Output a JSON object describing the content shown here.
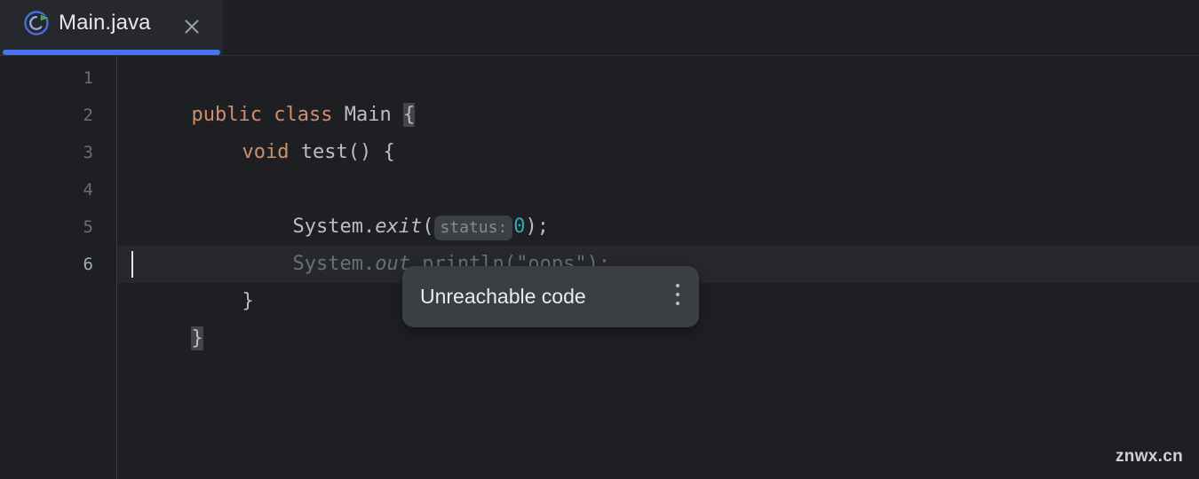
{
  "window": {
    "background": "#1e1f22",
    "watermark": "znwx.cn"
  },
  "tab_bar": {
    "active_tab": {
      "label": "Main.java",
      "icon": "java-class-runnable-icon",
      "close_icon": "close-icon",
      "underline_color": "#4874ef",
      "background": "#26282e"
    }
  },
  "editor": {
    "language": "java",
    "caret": {
      "line": 6,
      "column": 2
    },
    "gutter": {
      "line_numbers": [
        "1",
        "2",
        "3",
        "4",
        "5",
        "6"
      ],
      "current_line": "6"
    },
    "colors": {
      "keyword": "#cf8e6d",
      "identifier": "#bcbec4",
      "number": "#2aacb8",
      "string": "#6aab73",
      "greyed_out": "#6b6f76",
      "inlay_background": "#3c3f43",
      "inlay_text": "#868a91",
      "brace_match_highlight": "#43454a",
      "caret_line": "#26282e"
    },
    "lines": [
      {
        "number": "1",
        "indent": 0,
        "tokens": [
          {
            "text": "public",
            "style": "keyword"
          },
          {
            "text": " ",
            "style": "plain"
          },
          {
            "text": "class",
            "style": "keyword"
          },
          {
            "text": " ",
            "style": "plain"
          },
          {
            "text": "Main",
            "style": "identifier"
          },
          {
            "text": " ",
            "style": "plain"
          },
          {
            "text": "{",
            "style": "brace-match"
          }
        ]
      },
      {
        "number": "2",
        "indent": 4,
        "tokens": [
          {
            "text": "void",
            "style": "keyword"
          },
          {
            "text": " ",
            "style": "plain"
          },
          {
            "text": "test",
            "style": "identifier"
          },
          {
            "text": "() {",
            "style": "plain"
          }
        ]
      },
      {
        "number": "3",
        "indent": 8,
        "tokens": [
          {
            "text": "System.",
            "style": "plain"
          },
          {
            "text": "exit",
            "style": "italic"
          },
          {
            "text": "(",
            "style": "plain"
          },
          {
            "text": "status:",
            "style": "inlay-hint"
          },
          {
            "text": "0",
            "style": "number"
          },
          {
            "text": ");",
            "style": "plain"
          }
        ]
      },
      {
        "number": "4",
        "indent": 8,
        "greyed_out": true,
        "tokens": [
          {
            "text": "System.",
            "style": "greyed"
          },
          {
            "text": "out",
            "style": "greyed-italic"
          },
          {
            "text": ".println(\"oops\");",
            "style": "greyed"
          }
        ]
      },
      {
        "number": "5",
        "indent": 4,
        "tokens": [
          {
            "text": "}",
            "style": "plain"
          }
        ]
      },
      {
        "number": "6",
        "indent": 0,
        "current": true,
        "tokens": [
          {
            "text": "}",
            "style": "brace-match"
          }
        ]
      }
    ],
    "source_text": "public class Main {\n    void test() {\n        System.exit( status: 0);\n        System.out.println(\"oops\");\n    }\n}"
  },
  "tooltip": {
    "message": "Unreachable code",
    "menu_icon": "more-options-vertical-dots-icon",
    "background": "#3c3f41",
    "anchored_to_line": "4"
  }
}
